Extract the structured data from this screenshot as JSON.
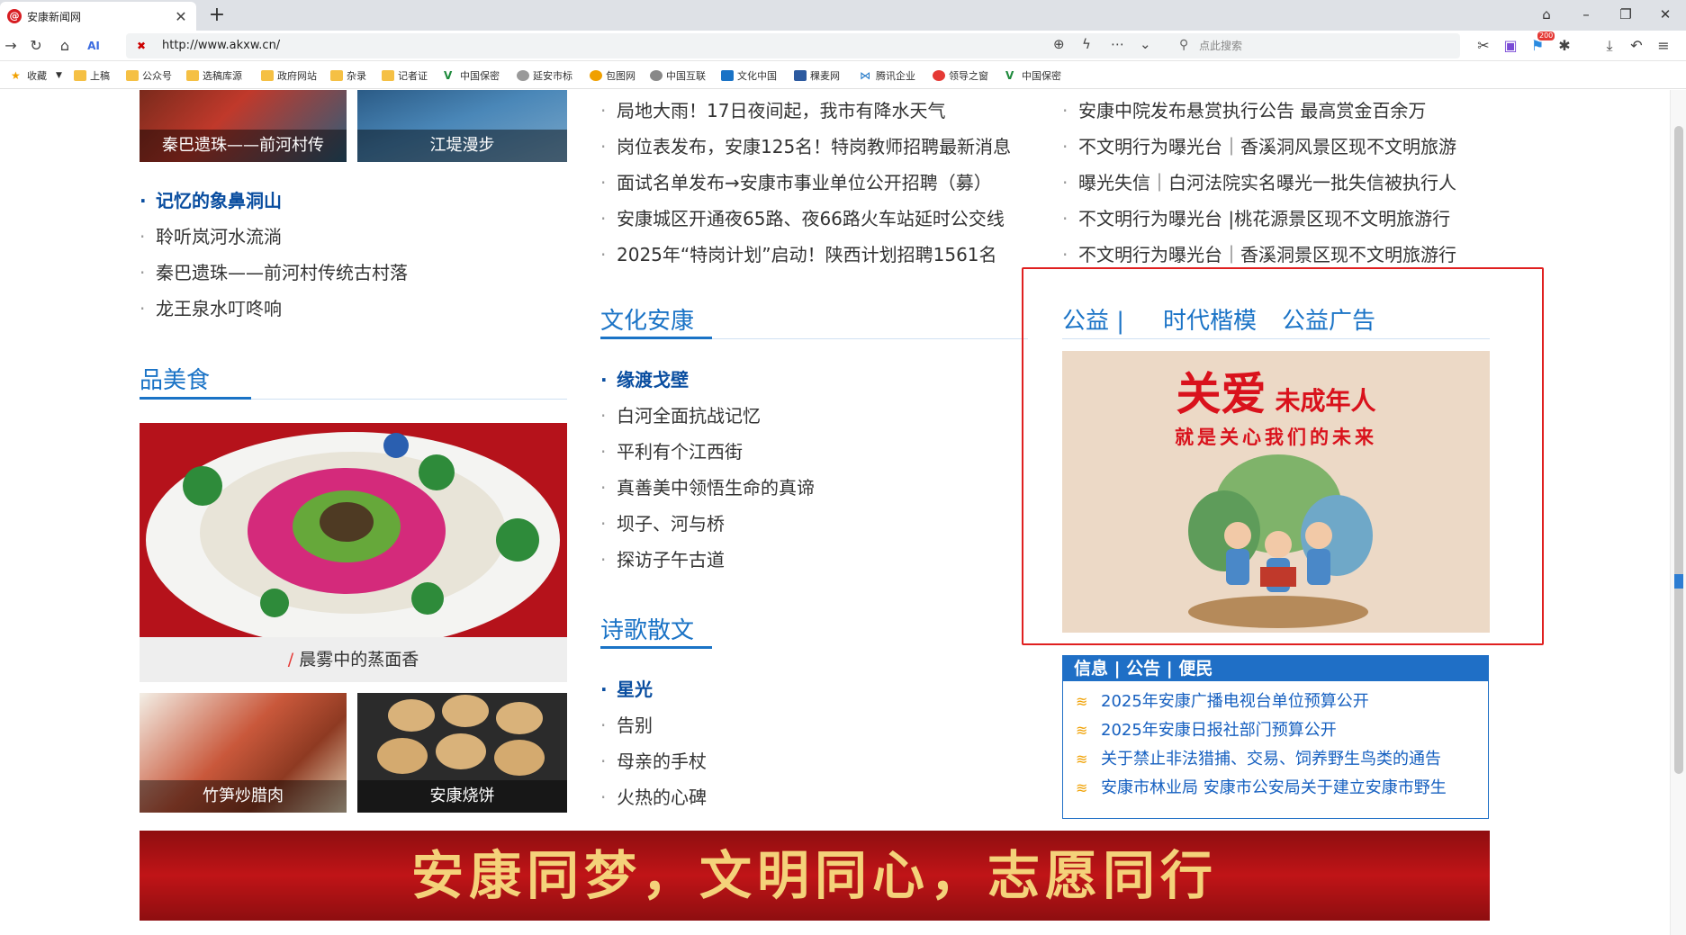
{
  "browser": {
    "tab_title": "安康新闻网",
    "url": "http://www.akxw.cn/",
    "search_placeholder": "点此搜索",
    "notification_badge": "200"
  },
  "bookmarks": [
    {
      "label": "收藏",
      "icon": "star-icon"
    },
    {
      "label": "上稿",
      "icon": "folder-icon"
    },
    {
      "label": "公众号",
      "icon": "folder-icon"
    },
    {
      "label": "选稿库源",
      "icon": "folder-icon"
    },
    {
      "label": "政府网站",
      "icon": "folder-icon"
    },
    {
      "label": "杂录",
      "icon": "folder-icon"
    },
    {
      "label": "记者证",
      "icon": "folder-icon"
    },
    {
      "label": "中国保密",
      "icon": "site-icon"
    },
    {
      "label": "延安市标",
      "icon": "site-icon"
    },
    {
      "label": "包图网",
      "icon": "site-icon"
    },
    {
      "label": "中国互联",
      "icon": "site-icon"
    },
    {
      "label": "文化中国",
      "icon": "site-icon"
    },
    {
      "label": "稞麦网",
      "icon": "site-icon"
    },
    {
      "label": "腾讯企业",
      "icon": "site-icon"
    },
    {
      "label": "领导之窗",
      "icon": "site-icon"
    },
    {
      "label": "中国保密",
      "icon": "site-icon"
    }
  ],
  "left": {
    "top_images": [
      {
        "caption": "秦巴遗珠——前河村传"
      },
      {
        "caption": "江堤漫步"
      }
    ],
    "list1": [
      {
        "text": "记忆的象鼻洞山",
        "bold": true
      },
      {
        "text": "聆听岚河水流淌",
        "bold": false
      },
      {
        "text": "秦巴遗珠——前河村传统古村落",
        "bold": false
      },
      {
        "text": "龙王泉水叮咚响",
        "bold": false
      }
    ],
    "section_title": "品美食",
    "food_main_caption": "晨雾中的蒸面香",
    "food_main_mark": "/",
    "food_small": [
      {
        "caption": "竹笋炒腊肉"
      },
      {
        "caption": "安康烧饼"
      }
    ]
  },
  "middle": {
    "news_list": [
      "局地大雨！17日夜间起，我市有降水天气",
      "岗位表发布，安康125名！特岗教师招聘最新消息",
      "面试名单发布→安康市事业单位公开招聘（募）",
      "安康城区开通夜65路、夜66路火车站延时公交线",
      "2025年“特岗计划”启动！陕西计划招聘1561名"
    ],
    "culture_title": "文化安康",
    "culture_list": [
      {
        "text": "缘渡戈壁",
        "bold": true
      },
      {
        "text": "白河全面抗战记忆",
        "bold": false
      },
      {
        "text": "平利有个江西街",
        "bold": false
      },
      {
        "text": "真善美中领悟生命的真谛",
        "bold": false
      },
      {
        "text": "坝子、河与桥",
        "bold": false
      },
      {
        "text": "探访子午古道",
        "bold": false
      }
    ],
    "poetry_title": "诗歌散文",
    "poetry_list": [
      {
        "text": "星光",
        "bold": true
      },
      {
        "text": "告别",
        "bold": false
      },
      {
        "text": "母亲的手杖",
        "bold": false
      },
      {
        "text": "火热的心碑",
        "bold": false
      }
    ]
  },
  "right": {
    "news_list": [
      "安康中院发布悬赏执行公告 最高赏金百余万",
      "不文明行为曝光台｜香溪洞风景区现不文明旅游",
      "曝光失信｜白河法院实名曝光一批失信被执行人",
      "不文明行为曝光台 |桃花源景区现不文明旅游行",
      "不文明行为曝光台｜香溪洞景区现不文明旅游行"
    ],
    "public_tabs": [
      "公益 |",
      "时代楷模",
      "公益广告"
    ],
    "poster_line1_big": "关爱",
    "poster_line1_small": "未成年人",
    "poster_line2": "就是关心我们的未来",
    "info_header": "信息 | 公告 | 便民",
    "info_items": [
      "2025年安康广播电视台单位预算公开",
      "2025年安康日报社部门预算公开",
      "关于禁止非法猎捕、交易、饲养野生鸟类的通告",
      "安康市林业局 安康市公安局关于建立安康市野生"
    ]
  },
  "banner_text": "安康同梦，文明同心，志愿同行",
  "colors": {
    "accent_blue": "#1a73c6",
    "highlight_red": "#e02020",
    "banner_red": "#b01214",
    "banner_gold": "#f4d27a"
  }
}
